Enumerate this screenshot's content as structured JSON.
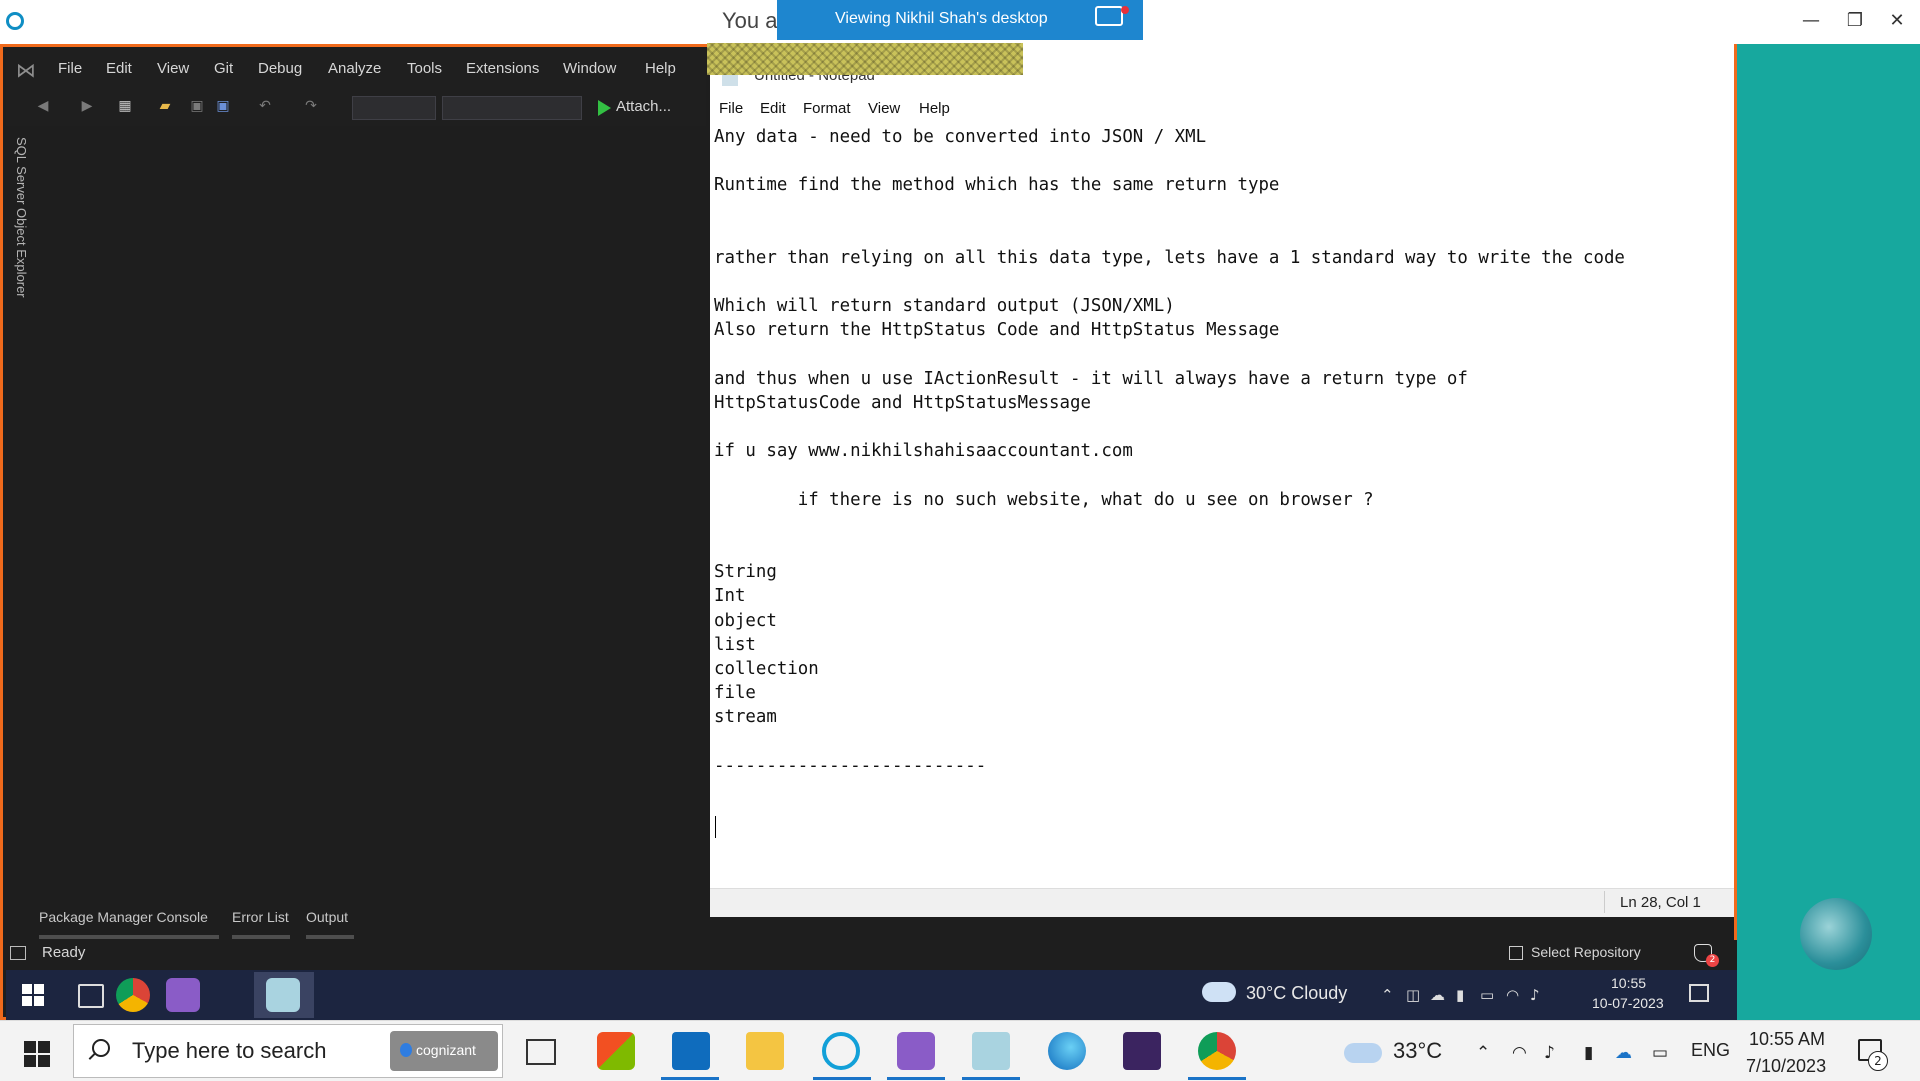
{
  "host": {
    "title_partial": "You a",
    "share_banner": "Viewing Nikhil Shah's desktop",
    "controls": {
      "minimize": "—",
      "restore": "❐",
      "close": "✕"
    }
  },
  "vs": {
    "menu": [
      "File",
      "Edit",
      "View",
      "Git",
      "Debug",
      "Analyze",
      "Tools",
      "Extensions",
      "Window",
      "Help"
    ],
    "attach_label": "Attach...",
    "side_tab": "SQL Server Object Explorer",
    "bottom_tabs": [
      "Package Manager Console",
      "Error List",
      "Output"
    ],
    "status_ready": "Ready",
    "select_repository": "Select Repository",
    "notification_count": "2"
  },
  "inner_taskbar": {
    "weather": "30°C  Cloudy",
    "time": "10:55",
    "date": "10-07-2023"
  },
  "notepad": {
    "title": "Untitled - Notepad",
    "menu": [
      "File",
      "Edit",
      "Format",
      "View",
      "Help"
    ],
    "lines": [
      "Any data - need to be converted into JSON / XML",
      "",
      "Runtime find the method which has the same return type",
      "",
      "",
      "rather than relying on all this data type, lets have a 1 standard way to write the code",
      "",
      "Which will return standard output (JSON/XML)",
      "Also return the HttpStatus Code and HttpStatus Message",
      "",
      "and thus when u use IActionResult - it will always have a return type of",
      "HttpStatusCode and HttpStatusMessage",
      "",
      "if u say www.nikhilshahisaaccountant.com",
      "",
      "        if there is no such website, what do u see on browser ?",
      "",
      "",
      "String",
      "Int",
      "object",
      "list",
      "collection",
      "file",
      "stream",
      "",
      "--------------------------",
      ""
    ],
    "status_position": "Ln 28, Col 1"
  },
  "host_taskbar": {
    "search_placeholder": "Type here to search",
    "cognizant": "cognizant",
    "weather": "33°C",
    "lang": "ENG",
    "time": "10:55 AM",
    "date": "7/10/2023",
    "notification_count": "2"
  },
  "colors": {
    "accent_orange": "#f06a1c",
    "teal": "#17a89e",
    "banner_blue": "#1e86cf"
  }
}
